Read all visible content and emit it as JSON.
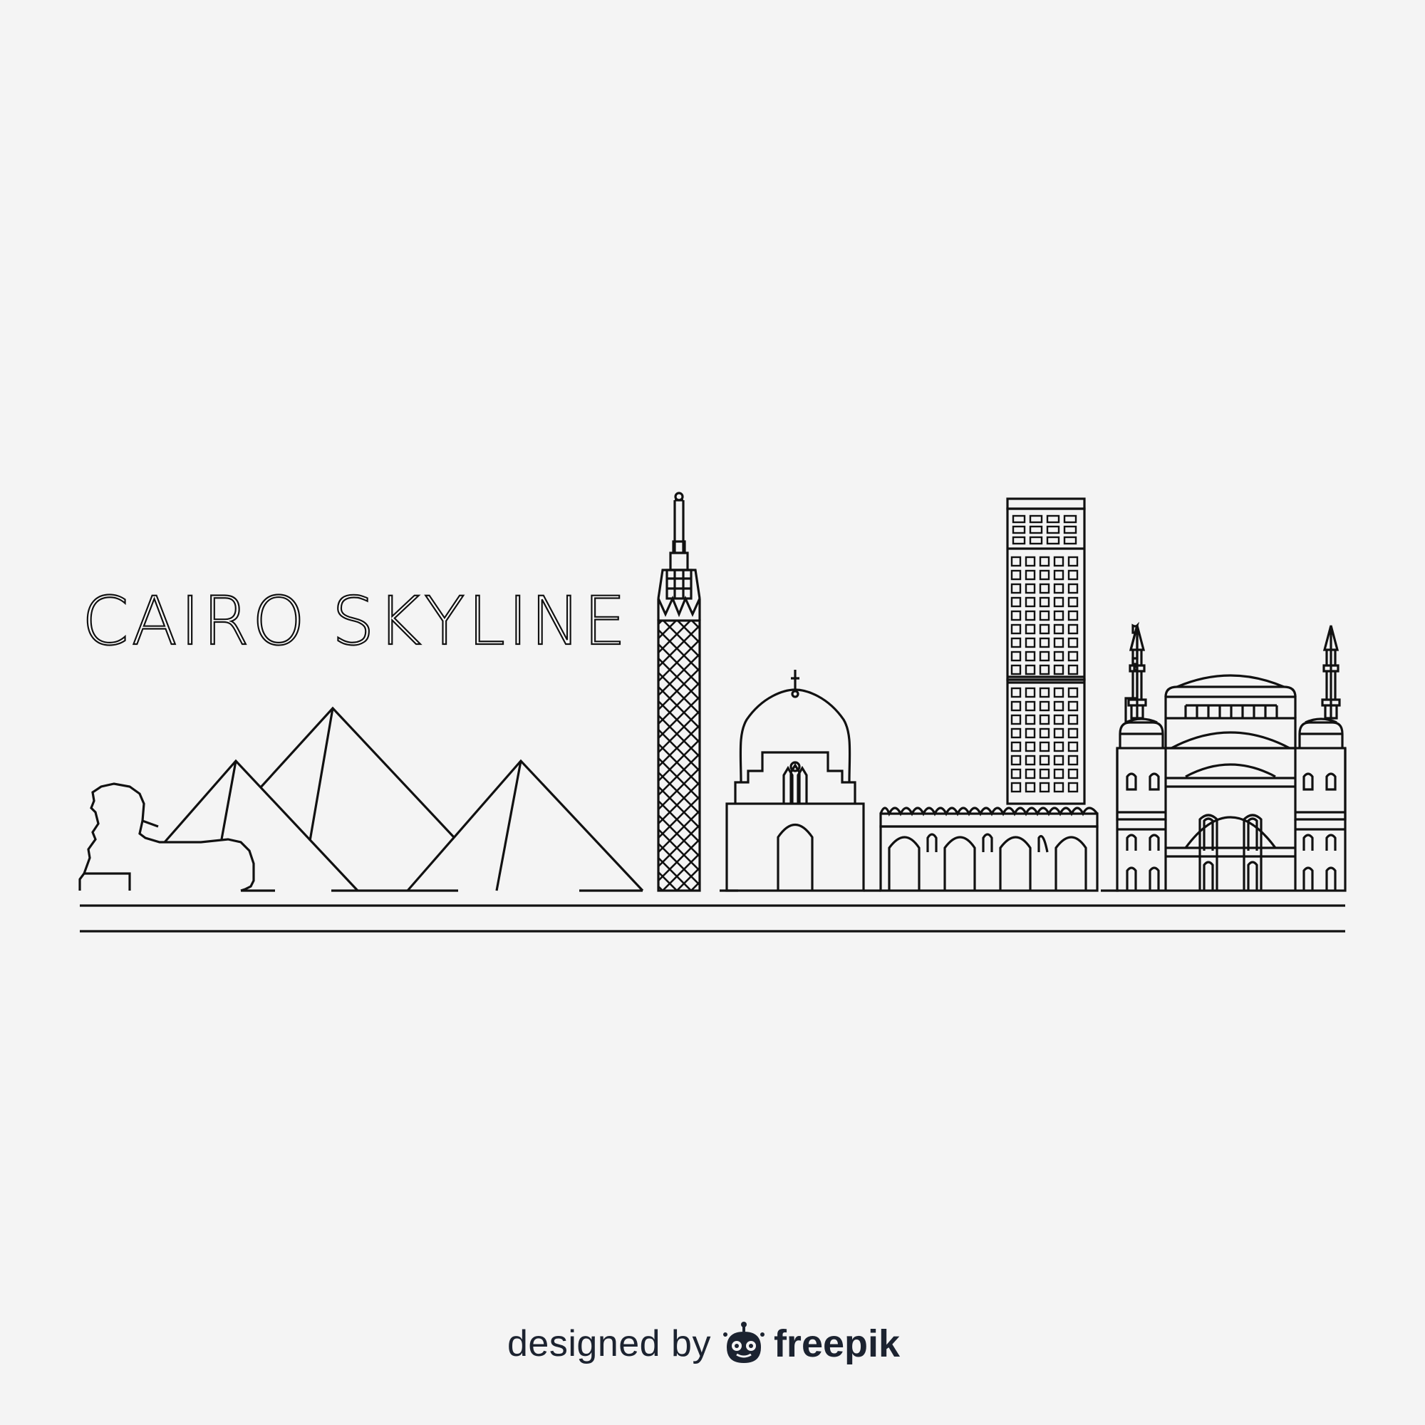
{
  "title": "CAIRO SKYLINE",
  "credit": {
    "prefix": "designed by",
    "brand": "freepik",
    "logo_icon": "freepik-robot-logo-icon"
  },
  "colors": {
    "background": "#f4f4f4",
    "line": "#111111",
    "credit_text": "#1c2330"
  }
}
